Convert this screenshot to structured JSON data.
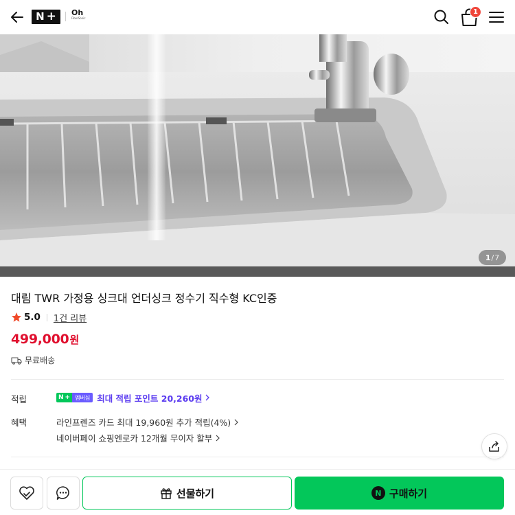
{
  "header": {
    "brand_n": "N",
    "brand_plus": "+",
    "store_logo": "Oh",
    "store_logo_sub": "FiberSonic",
    "cart_count": "1",
    "icons": [
      "back-arrow-icon",
      "search-icon",
      "shopping-bag-icon",
      "hamburger-menu-icon"
    ]
  },
  "gallery": {
    "current": "1",
    "separator": "/",
    "total": "7"
  },
  "product": {
    "title": "대림 TWR 가정용 싱크대 언더싱크 정수기 직수형 KC인증",
    "rating": "5.0",
    "review_link": "1건 리뷰",
    "price_number": "499,000",
    "price_unit": "원",
    "shipping": "무료배송"
  },
  "accrual": {
    "label": "적립",
    "badge_left": "N",
    "badge_plus": "+",
    "badge_right": "멤버십",
    "text": "최대 적립 포인트 20,260원"
  },
  "benefits": {
    "label": "혜택",
    "line1": "라인프렌즈 카드 최대 19,960원 추가 적립(4%)",
    "line2": "네이버페이 쇼핑엔로카 12개월 무이자 할부"
  },
  "bottom": {
    "gift_label": "선물하기",
    "buy_label": "구매하기",
    "buy_icon_letter": "N"
  },
  "colors": {
    "price_red": "#e0102f",
    "naver_green": "#03c75a",
    "membership_purple": "#5b3cf0",
    "badge_red": "#f0453a",
    "star_red": "#f04a2a"
  }
}
